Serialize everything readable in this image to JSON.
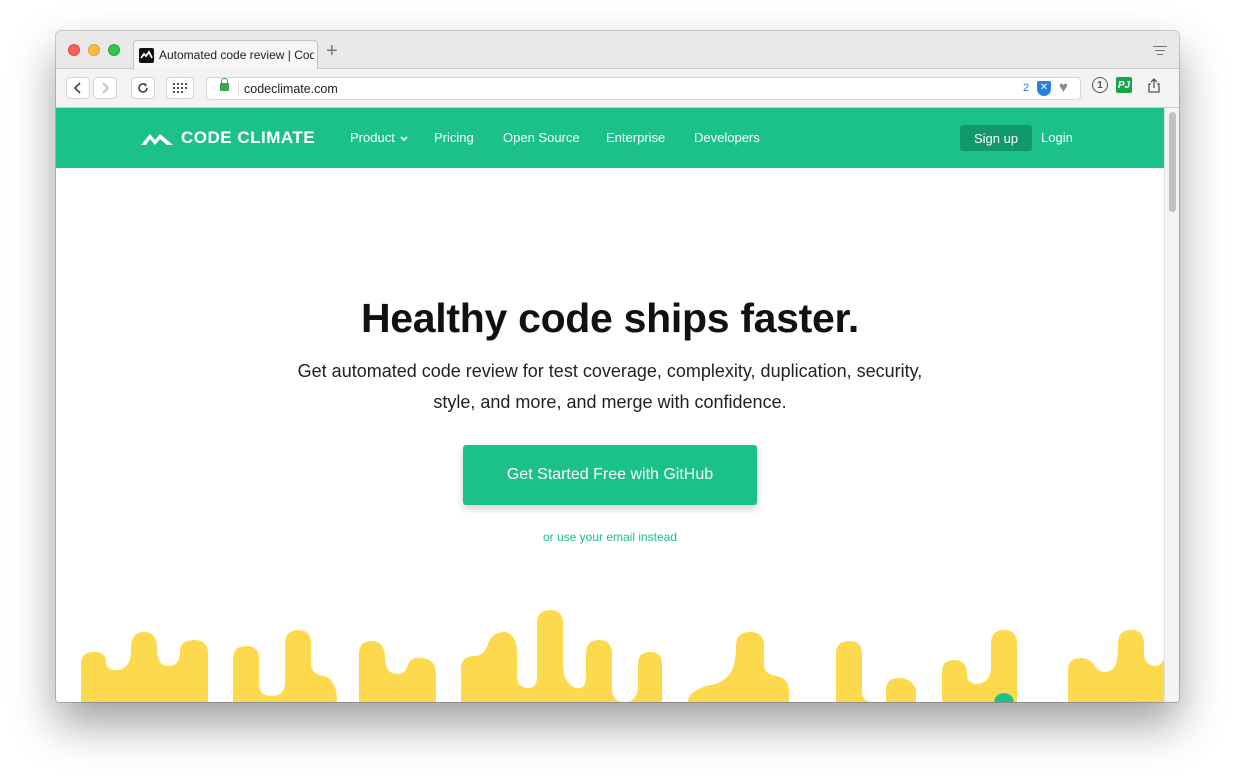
{
  "browser": {
    "tab_title": "Automated code review | Code Climate",
    "new_tab": "+",
    "url": "codeclimate.com",
    "extension_badge_count": "2",
    "pj_label": "PJ",
    "onepassword_label": "1"
  },
  "nav": {
    "logo_text": "CODE CLIMATE",
    "items": [
      {
        "label": "Product"
      },
      {
        "label": "Pricing"
      },
      {
        "label": "Open Source"
      },
      {
        "label": "Enterprise"
      },
      {
        "label": "Developers"
      }
    ],
    "signup_label": "Sign up",
    "login_label": "Login"
  },
  "hero": {
    "title": "Healthy code ships faster.",
    "subtitle": "Get automated code review for test coverage, complexity, duplication, security, style, and more, and merge with confidence.",
    "cta_label": "Get Started Free with GitHub",
    "email_link": "or use your email instead"
  },
  "colors": {
    "brand_green": "#1cc08a",
    "signup_green": "#11996a",
    "drip_yellow": "#fdd94e"
  },
  "icons": [
    "back-icon",
    "forward-icon",
    "reload-icon",
    "grid-icon",
    "lock-icon",
    "shield-icon",
    "heart-icon",
    "onepassword-icon",
    "pj-icon",
    "share-icon",
    "tab-menu-icon",
    "chevron-down-icon",
    "logo-mark-icon"
  ]
}
